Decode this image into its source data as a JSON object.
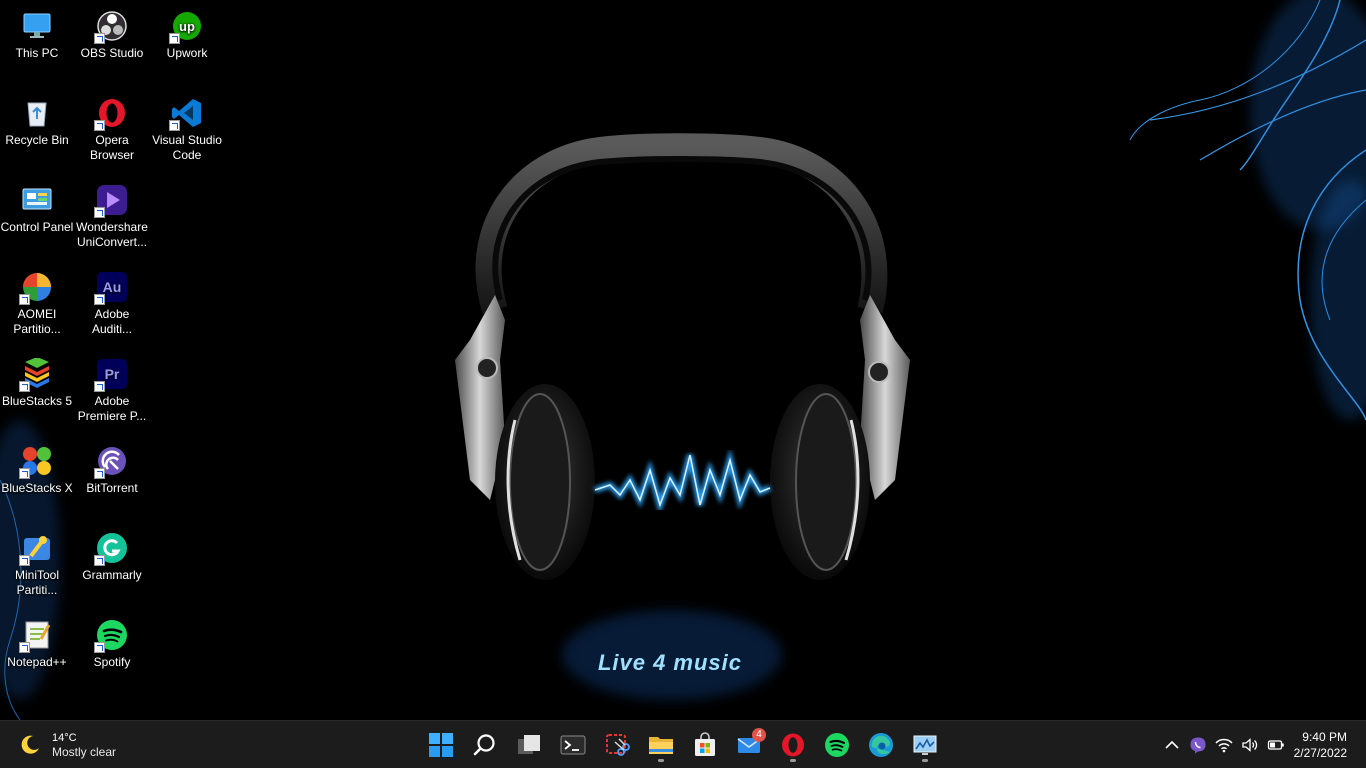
{
  "wallpaper": {
    "text": "Live 4 music"
  },
  "desktop_icons": [
    {
      "label": "This PC",
      "icon": "this-pc-icon"
    },
    {
      "label": "OBS Studio",
      "icon": "obs-studio-icon"
    },
    {
      "label": "Upwork",
      "icon": "upwork-icon"
    },
    {
      "label": "Recycle Bin",
      "icon": "recycle-bin-icon"
    },
    {
      "label": "Opera Browser",
      "icon": "opera-icon"
    },
    {
      "label": "Visual Studio Code",
      "icon": "vscode-icon"
    },
    {
      "label": "Control Panel",
      "icon": "control-panel-icon"
    },
    {
      "label": "Wondershare UniConvert...",
      "icon": "wondershare-icon"
    },
    {
      "label": "AOMEI Partitio...",
      "icon": "aomei-icon"
    },
    {
      "label": "Adobe Auditi...",
      "icon": "adobe-audition-icon"
    },
    {
      "label": "BlueStacks 5",
      "icon": "bluestacks5-icon"
    },
    {
      "label": "Adobe Premiere P...",
      "icon": "adobe-premiere-icon"
    },
    {
      "label": "BlueStacks X",
      "icon": "bluestacks-x-icon"
    },
    {
      "label": "BitTorrent",
      "icon": "bittorrent-icon"
    },
    {
      "label": "MiniTool Partiti...",
      "icon": "minitool-icon"
    },
    {
      "label": "Grammarly",
      "icon": "grammarly-icon"
    },
    {
      "label": "Notepad++",
      "icon": "notepadpp-icon"
    },
    {
      "label": "Spotify",
      "icon": "spotify-icon"
    }
  ],
  "weather": {
    "temperature": "14°C",
    "condition": "Mostly clear"
  },
  "taskbar_apps": [
    {
      "name": "start",
      "icon": "windows-start-icon"
    },
    {
      "name": "search",
      "icon": "search-icon"
    },
    {
      "name": "task-view",
      "icon": "task-view-icon"
    },
    {
      "name": "terminal",
      "icon": "terminal-icon"
    },
    {
      "name": "snipping-tool",
      "icon": "snipping-tool-icon"
    },
    {
      "name": "file-explorer",
      "icon": "folder-icon",
      "running": true
    },
    {
      "name": "microsoft-store",
      "icon": "store-icon"
    },
    {
      "name": "mail",
      "icon": "mail-icon",
      "badge": "4"
    },
    {
      "name": "opera",
      "icon": "opera-icon",
      "running": true
    },
    {
      "name": "spotify",
      "icon": "spotify-icon"
    },
    {
      "name": "edge",
      "icon": "edge-icon"
    },
    {
      "name": "resource-monitor",
      "icon": "monitor-chart-icon",
      "running": true
    }
  ],
  "tray": [
    "chevron-up-icon",
    "viber-icon",
    "wifi-icon",
    "volume-icon",
    "battery-icon"
  ],
  "clock": {
    "time": "9:40 PM",
    "date": "2/27/2022"
  },
  "colors": {
    "taskbar": "#1c1c1c",
    "accent": "#0078d4",
    "glow": "#3fb6ff"
  }
}
